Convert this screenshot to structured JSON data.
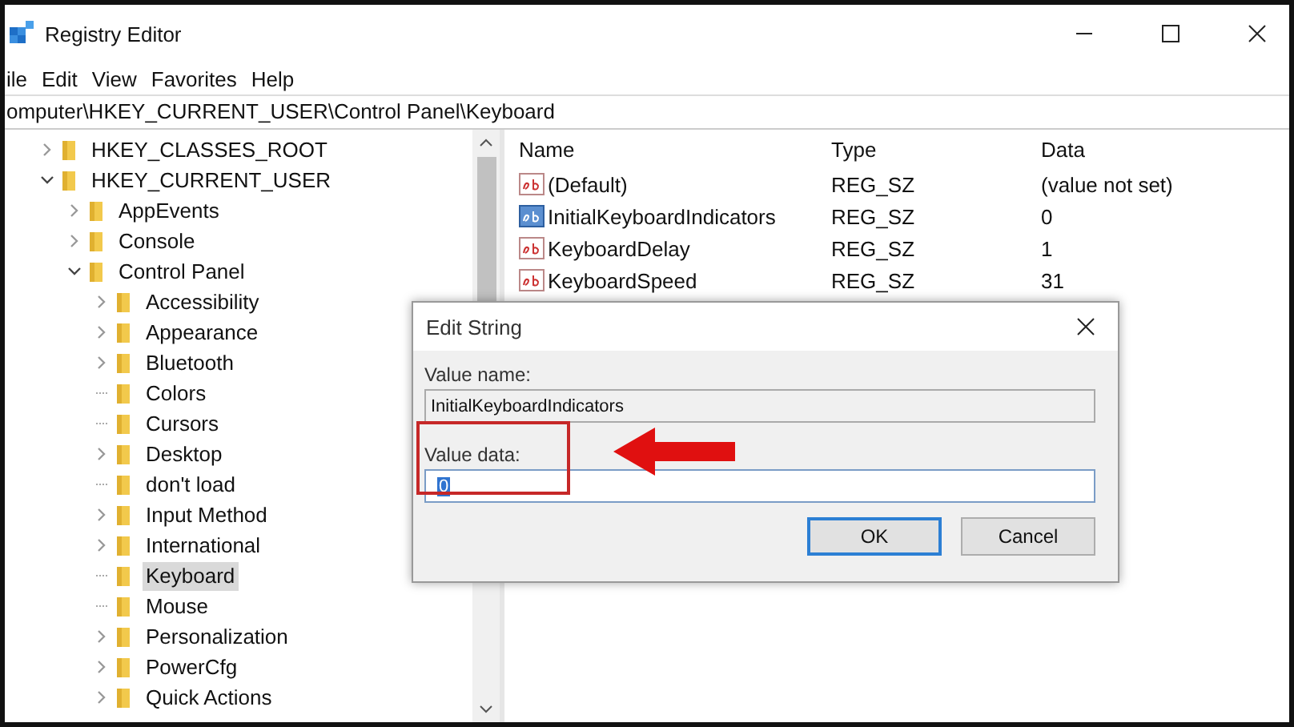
{
  "window": {
    "title": "Registry Editor"
  },
  "menu": [
    "ile",
    "Edit",
    "View",
    "Favorites",
    "Help"
  ],
  "address": "omputer\\HKEY_CURRENT_USER\\Control Panel\\Keyboard",
  "tree": [
    {
      "label": "HKEY_CLASSES_ROOT",
      "kind": "branch",
      "expanded": false,
      "selected": false
    },
    {
      "label": "HKEY_CURRENT_USER",
      "kind": "branch",
      "expanded": true,
      "selected": false,
      "children": [
        {
          "label": "AppEvents",
          "kind": "branch",
          "expanded": false,
          "selected": false
        },
        {
          "label": "Console",
          "kind": "branch",
          "expanded": false,
          "selected": false
        },
        {
          "label": "Control Panel",
          "kind": "branch",
          "expanded": true,
          "selected": false,
          "children": [
            {
              "label": "Accessibility",
              "kind": "branch",
              "expanded": false,
              "selected": false
            },
            {
              "label": "Appearance",
              "kind": "branch",
              "expanded": false,
              "selected": false
            },
            {
              "label": "Bluetooth",
              "kind": "branch",
              "expanded": false,
              "selected": false
            },
            {
              "label": "Colors",
              "kind": "leaf",
              "selected": false
            },
            {
              "label": "Cursors",
              "kind": "leaf",
              "selected": false
            },
            {
              "label": "Desktop",
              "kind": "branch",
              "expanded": false,
              "selected": false
            },
            {
              "label": "don't load",
              "kind": "leaf",
              "selected": false
            },
            {
              "label": "Input Method",
              "kind": "branch",
              "expanded": false,
              "selected": false
            },
            {
              "label": "International",
              "kind": "branch",
              "expanded": false,
              "selected": false
            },
            {
              "label": "Keyboard",
              "kind": "leaf",
              "selected": true
            },
            {
              "label": "Mouse",
              "kind": "leaf",
              "selected": false
            },
            {
              "label": "Personalization",
              "kind": "branch",
              "expanded": false,
              "selected": false
            },
            {
              "label": "PowerCfg",
              "kind": "branch",
              "expanded": false,
              "selected": false
            },
            {
              "label": "Quick Actions",
              "kind": "branch",
              "expanded": false,
              "selected": false
            }
          ]
        }
      ]
    }
  ],
  "values": {
    "columns": [
      "Name",
      "Type",
      "Data"
    ],
    "rows": [
      {
        "name": "(Default)",
        "type": "REG_SZ",
        "data": "(value not set)",
        "selected": false
      },
      {
        "name": "InitialKeyboardIndicators",
        "type": "REG_SZ",
        "data": "0",
        "selected": true
      },
      {
        "name": "KeyboardDelay",
        "type": "REG_SZ",
        "data": "1",
        "selected": false
      },
      {
        "name": "KeyboardSpeed",
        "type": "REG_SZ",
        "data": "31",
        "selected": false
      }
    ]
  },
  "dialog": {
    "title": "Edit String",
    "value_name_label": "Value name:",
    "value_name": "InitialKeyboardIndicators",
    "value_data_label": "Value data:",
    "value_data": "0",
    "buttons": [
      "OK",
      "Cancel"
    ]
  }
}
